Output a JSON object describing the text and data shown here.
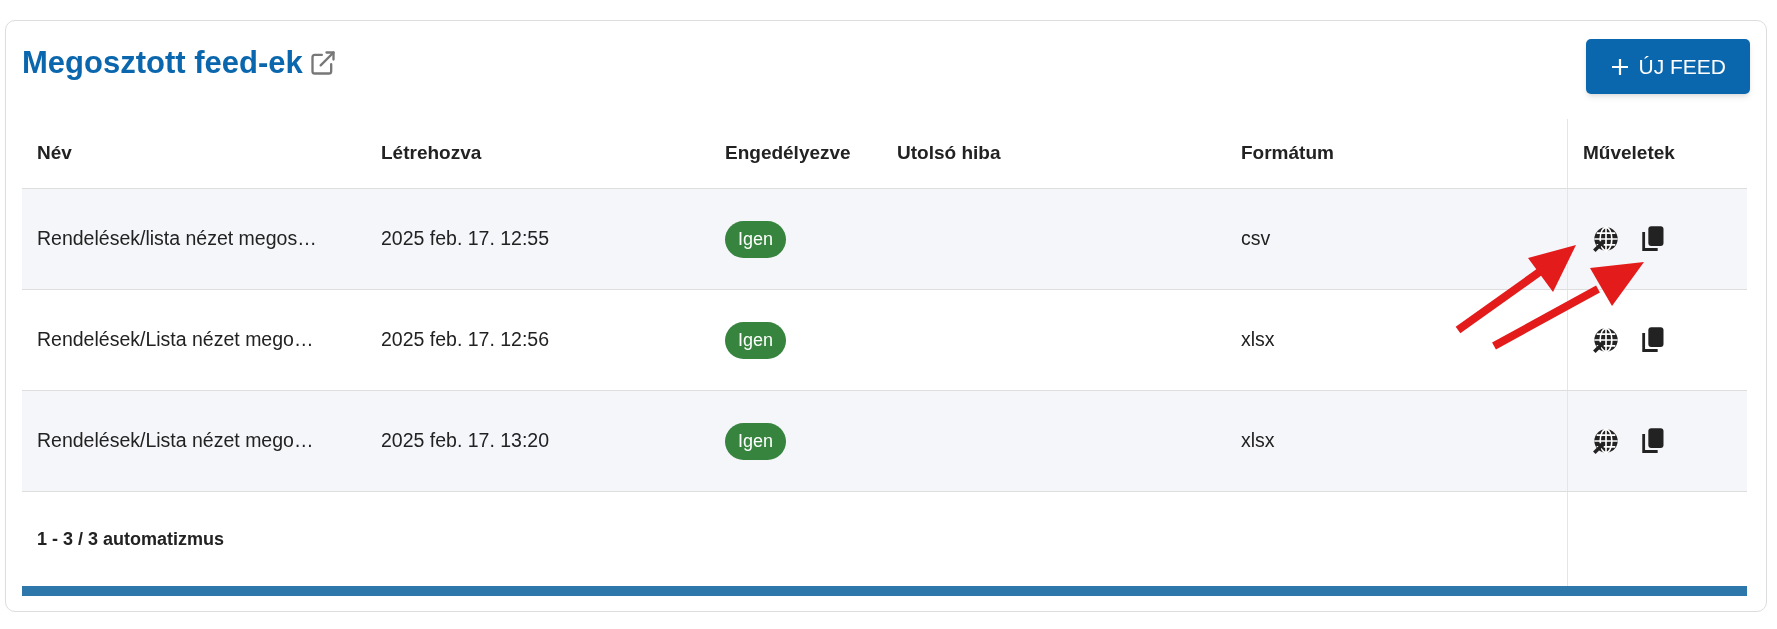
{
  "title": "Megosztott feed-ek",
  "new_button": {
    "label": "ÚJ FEED"
  },
  "table": {
    "columns": [
      "Név",
      "Létrehozva",
      "Engedélyezve",
      "Utolsó hiba",
      "Formátum",
      "Műveletek"
    ],
    "rows": [
      {
        "name": "Rendelések/lista nézet megos…",
        "created": "2025 feb. 17. 12:55",
        "enabled": "Igen",
        "last_error": "",
        "format": "csv"
      },
      {
        "name": "Rendelések/Lista nézet mego…",
        "created": "2025 feb. 17. 12:56",
        "enabled": "Igen",
        "last_error": "",
        "format": "xlsx"
      },
      {
        "name": "Rendelések/Lista nézet mego…",
        "created": "2025 feb. 17. 13:20",
        "enabled": "Igen",
        "last_error": "",
        "format": "xlsx"
      }
    ]
  },
  "footer": "1 - 3 / 3 automatizmus"
}
